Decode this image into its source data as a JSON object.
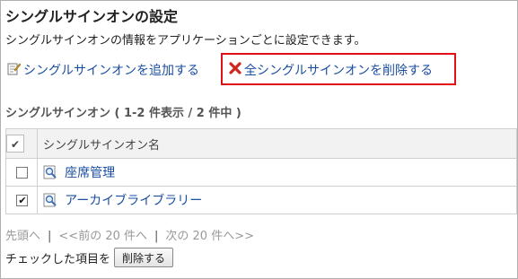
{
  "page": {
    "title": "シングルサインオンの設定",
    "description": "シングルサインオンの情報をアプリケーションごとに設定できます。"
  },
  "actions": {
    "add_label": "シングルサインオンを追加する",
    "delete_all_label": "全シングルサインオンを削除する",
    "highlight_color": "#e30f17"
  },
  "list": {
    "subheading": "シングルサインオン ( 1-2 件表示 / 2 件中 )",
    "column_header": "シングルサインオン名",
    "rows": [
      {
        "name": "座席管理",
        "checked": false
      },
      {
        "name": "アーカイブライブラリー",
        "checked": true
      }
    ]
  },
  "pager": {
    "first": "先頭へ",
    "prev": "<<前の 20 件へ",
    "next": "次の 20 件へ>>"
  },
  "bulk": {
    "label": "チェックした項目を",
    "button": "削除する"
  },
  "colors": {
    "link": "#1a4fa3",
    "header_bg": "#f2f2f2"
  }
}
